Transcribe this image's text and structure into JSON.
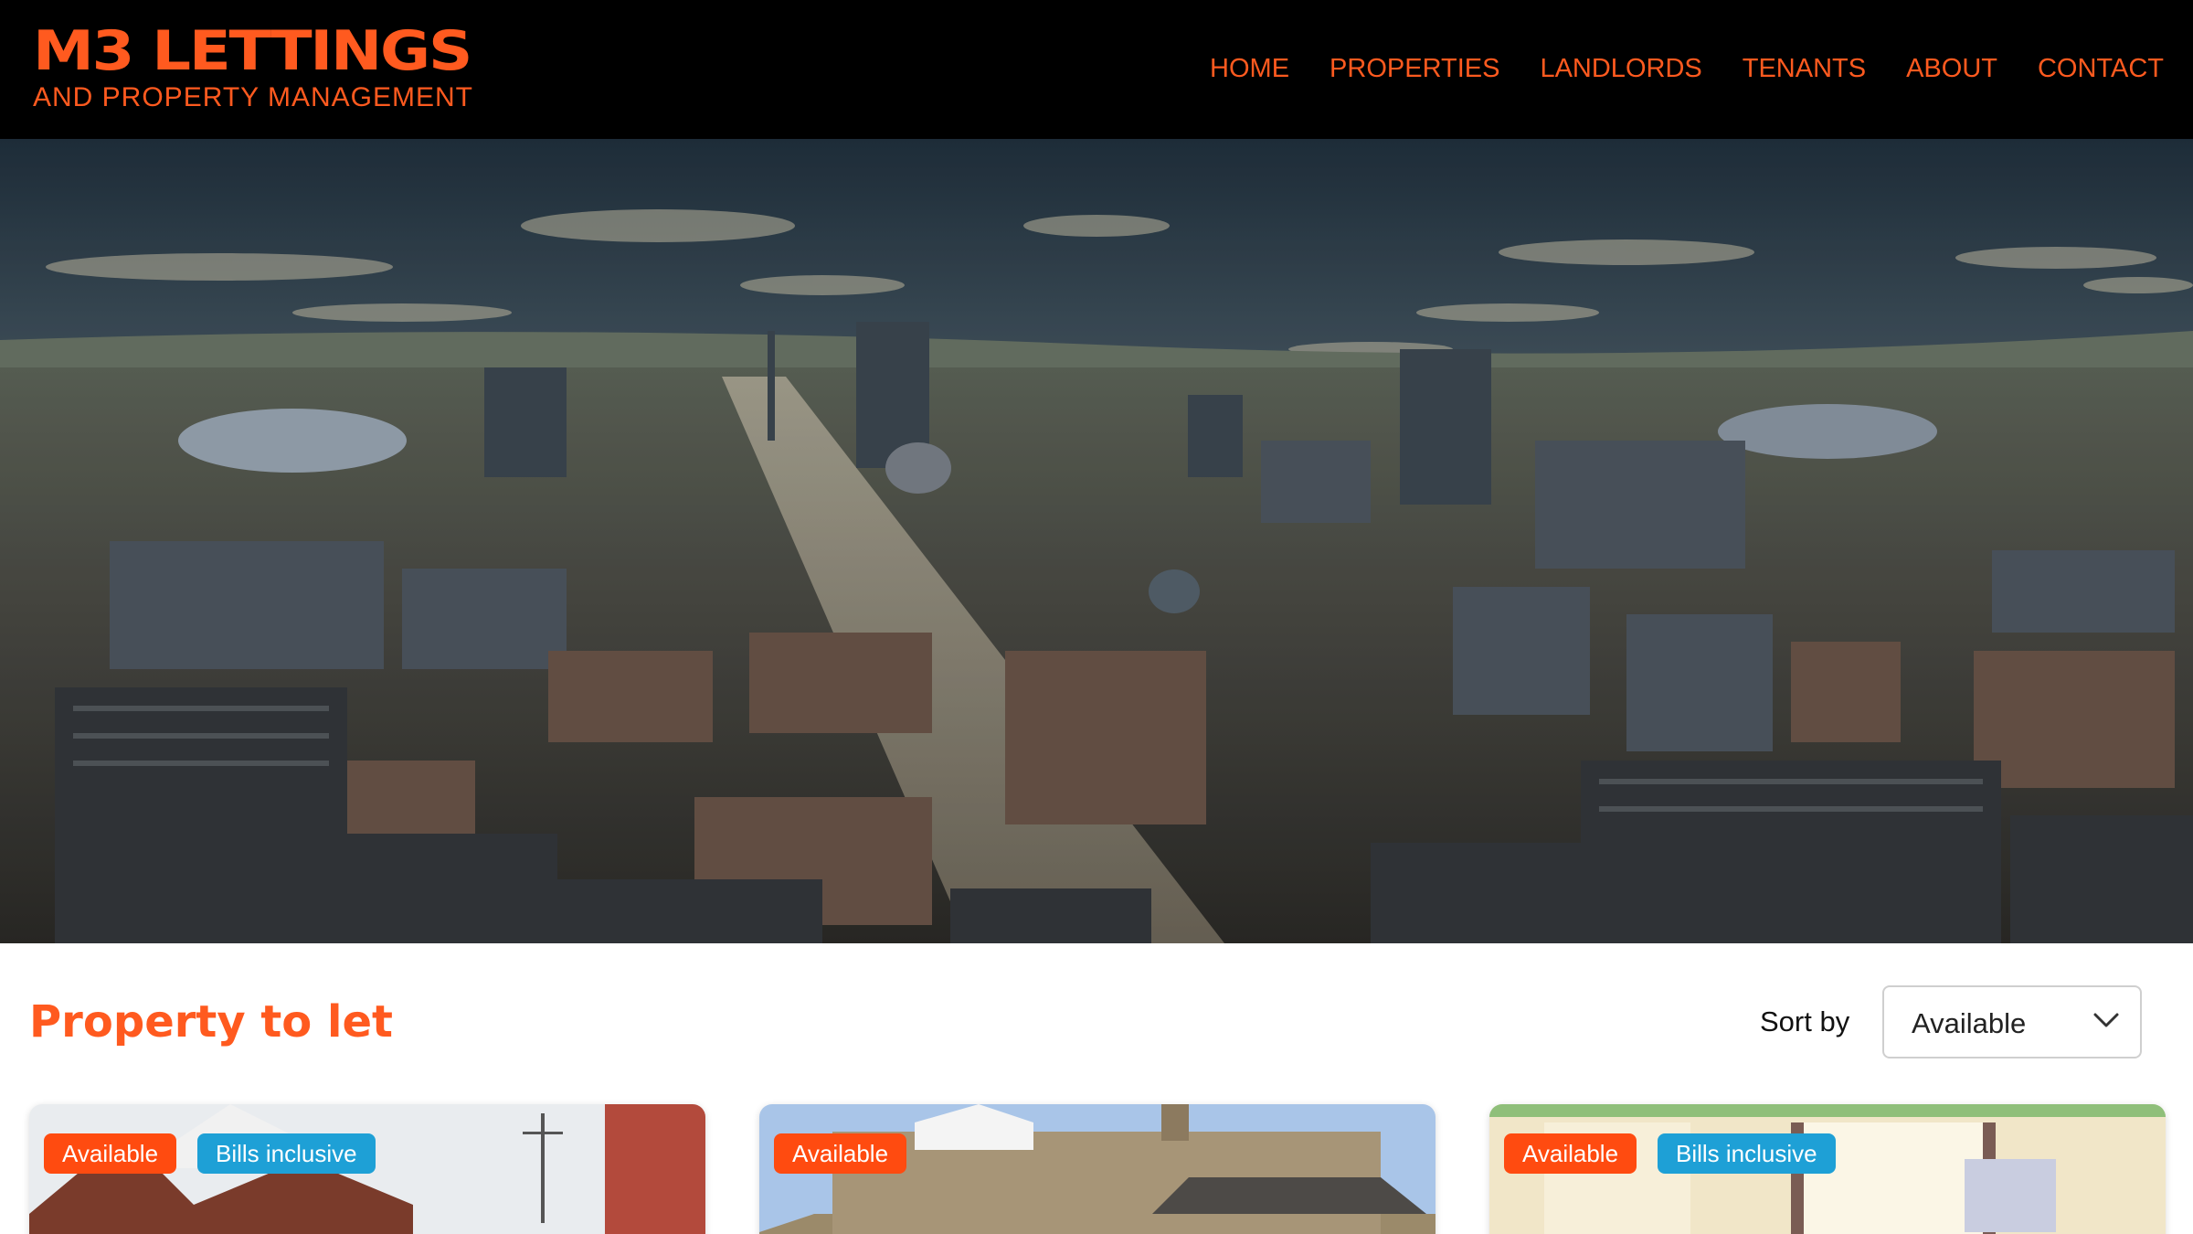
{
  "brand": {
    "name": "M3 LETTINGS",
    "tagline": "AND PROPERTY MANAGEMENT",
    "accent_color": "#ff5a1f"
  },
  "nav": {
    "items": [
      {
        "label": "HOME"
      },
      {
        "label": "PROPERTIES"
      },
      {
        "label": "LANDLORDS"
      },
      {
        "label": "TENANTS"
      },
      {
        "label": "ABOUT"
      },
      {
        "label": "CONTACT"
      }
    ]
  },
  "listing": {
    "title": "Property to let",
    "sort_label": "Sort by",
    "sort_value": "Available"
  },
  "cards": [
    {
      "badges": [
        "Available",
        "Bills inclusive"
      ]
    },
    {
      "badges": [
        "Available"
      ]
    },
    {
      "badges": [
        "Available",
        "Bills inclusive"
      ]
    }
  ],
  "colors": {
    "badge_available": "#ff4b10",
    "badge_bills": "#1ea0d6"
  }
}
